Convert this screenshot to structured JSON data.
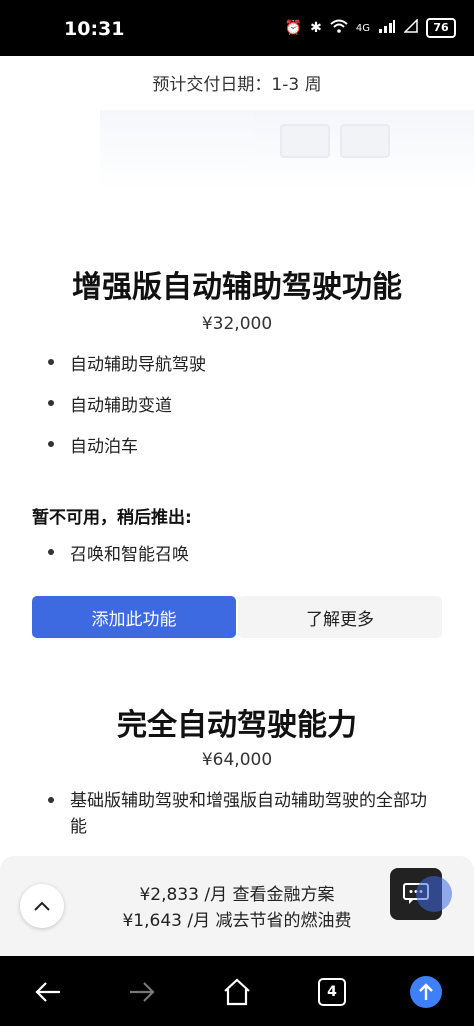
{
  "status_bar": {
    "time": "10:31",
    "network": "4G",
    "battery": "76"
  },
  "delivery": "预计交付日期：1-3 周",
  "enhanced": {
    "title": "增强版自动辅助驾驶功能",
    "price": "¥32,000",
    "features": [
      "自动辅助导航驾驶",
      "自动辅助变道",
      "自动泊车"
    ],
    "unavailable_heading": "暂不可用，稍后推出:",
    "unavailable_items": [
      "召唤和智能召唤"
    ],
    "add_button": "添加此功能",
    "learn_more_button": "了解更多"
  },
  "fsd": {
    "title": "完全自动驾驶能力",
    "price": "¥64,000",
    "features": [
      "基础版辅助驾驶和增强版自动辅助驾驶的全部功能"
    ]
  },
  "finance": {
    "monthly": "¥2,833 /月  查看金融方案",
    "fuel_saving": "¥1,643 /月  减去节省的燃油费"
  },
  "nav": {
    "tab_count": "4"
  },
  "colors": {
    "accent": "#3e6ae1",
    "upload": "#3e80f7"
  }
}
